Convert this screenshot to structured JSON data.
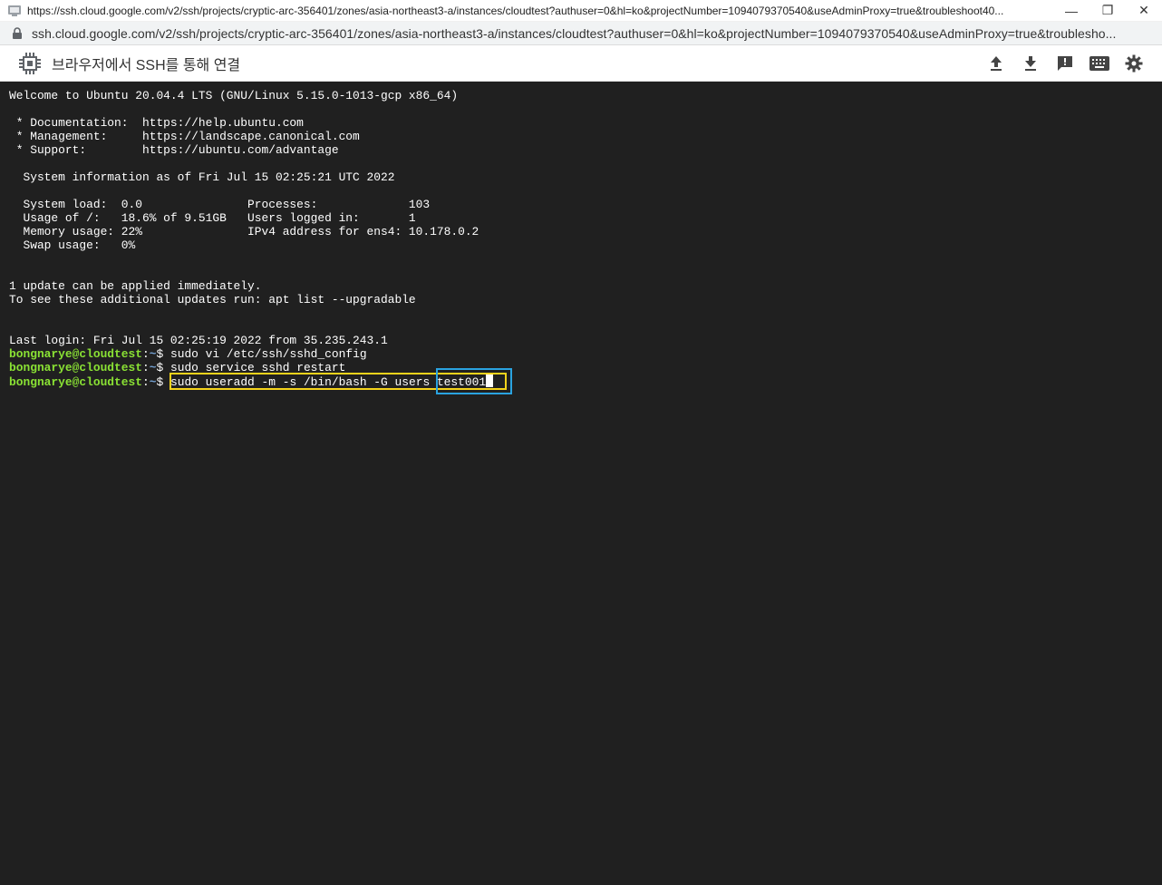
{
  "window": {
    "title": "https://ssh.cloud.google.com/v2/ssh/projects/cryptic-arc-356401/zones/asia-northeast3-a/instances/cloudtest?authuser=0&hl=ko&projectNumber=1094079370540&useAdminProxy=true&troubleshoot40...",
    "minimize_glyph": "—",
    "restore_glyph": "❐",
    "close_glyph": "✕"
  },
  "address": {
    "url": "ssh.cloud.google.com/v2/ssh/projects/cryptic-arc-356401/zones/asia-northeast3-a/instances/cloudtest?authuser=0&hl=ko&projectNumber=1094079370540&useAdminProxy=true&troublesho..."
  },
  "toolbar": {
    "title": "브라우저에서 SSH를 통해 연결",
    "icons": [
      "upload-icon",
      "download-icon",
      "feedback-icon",
      "keyboard-icon",
      "gear-icon"
    ]
  },
  "terminal": {
    "lines": [
      "Welcome to Ubuntu 20.04.4 LTS (GNU/Linux 5.15.0-1013-gcp x86_64)",
      "",
      " * Documentation:  https://help.ubuntu.com",
      " * Management:     https://landscape.canonical.com",
      " * Support:        https://ubuntu.com/advantage",
      "",
      "  System information as of Fri Jul 15 02:25:21 UTC 2022",
      "",
      "  System load:  0.0               Processes:             103",
      "  Usage of /:   18.6% of 9.51GB   Users logged in:       1",
      "  Memory usage: 22%               IPv4 address for ens4: 10.178.0.2",
      "  Swap usage:   0%",
      "",
      "",
      "1 update can be applied immediately.",
      "To see these additional updates run: apt list --upgradable",
      "",
      "",
      "Last login: Fri Jul 15 02:25:19 2022 from 35.235.243.1"
    ],
    "prompt_user": "bongnarye@cloudtest",
    "prompt_sep": ":",
    "prompt_dir": "~",
    "prompt_end": "$ ",
    "commands": [
      "sudo vi /etc/ssh/sshd_config",
      "sudo service sshd restart"
    ],
    "current_command_main": "sudo useradd -m -s /bin/bash -G users ",
    "current_command_arg": "test001"
  }
}
